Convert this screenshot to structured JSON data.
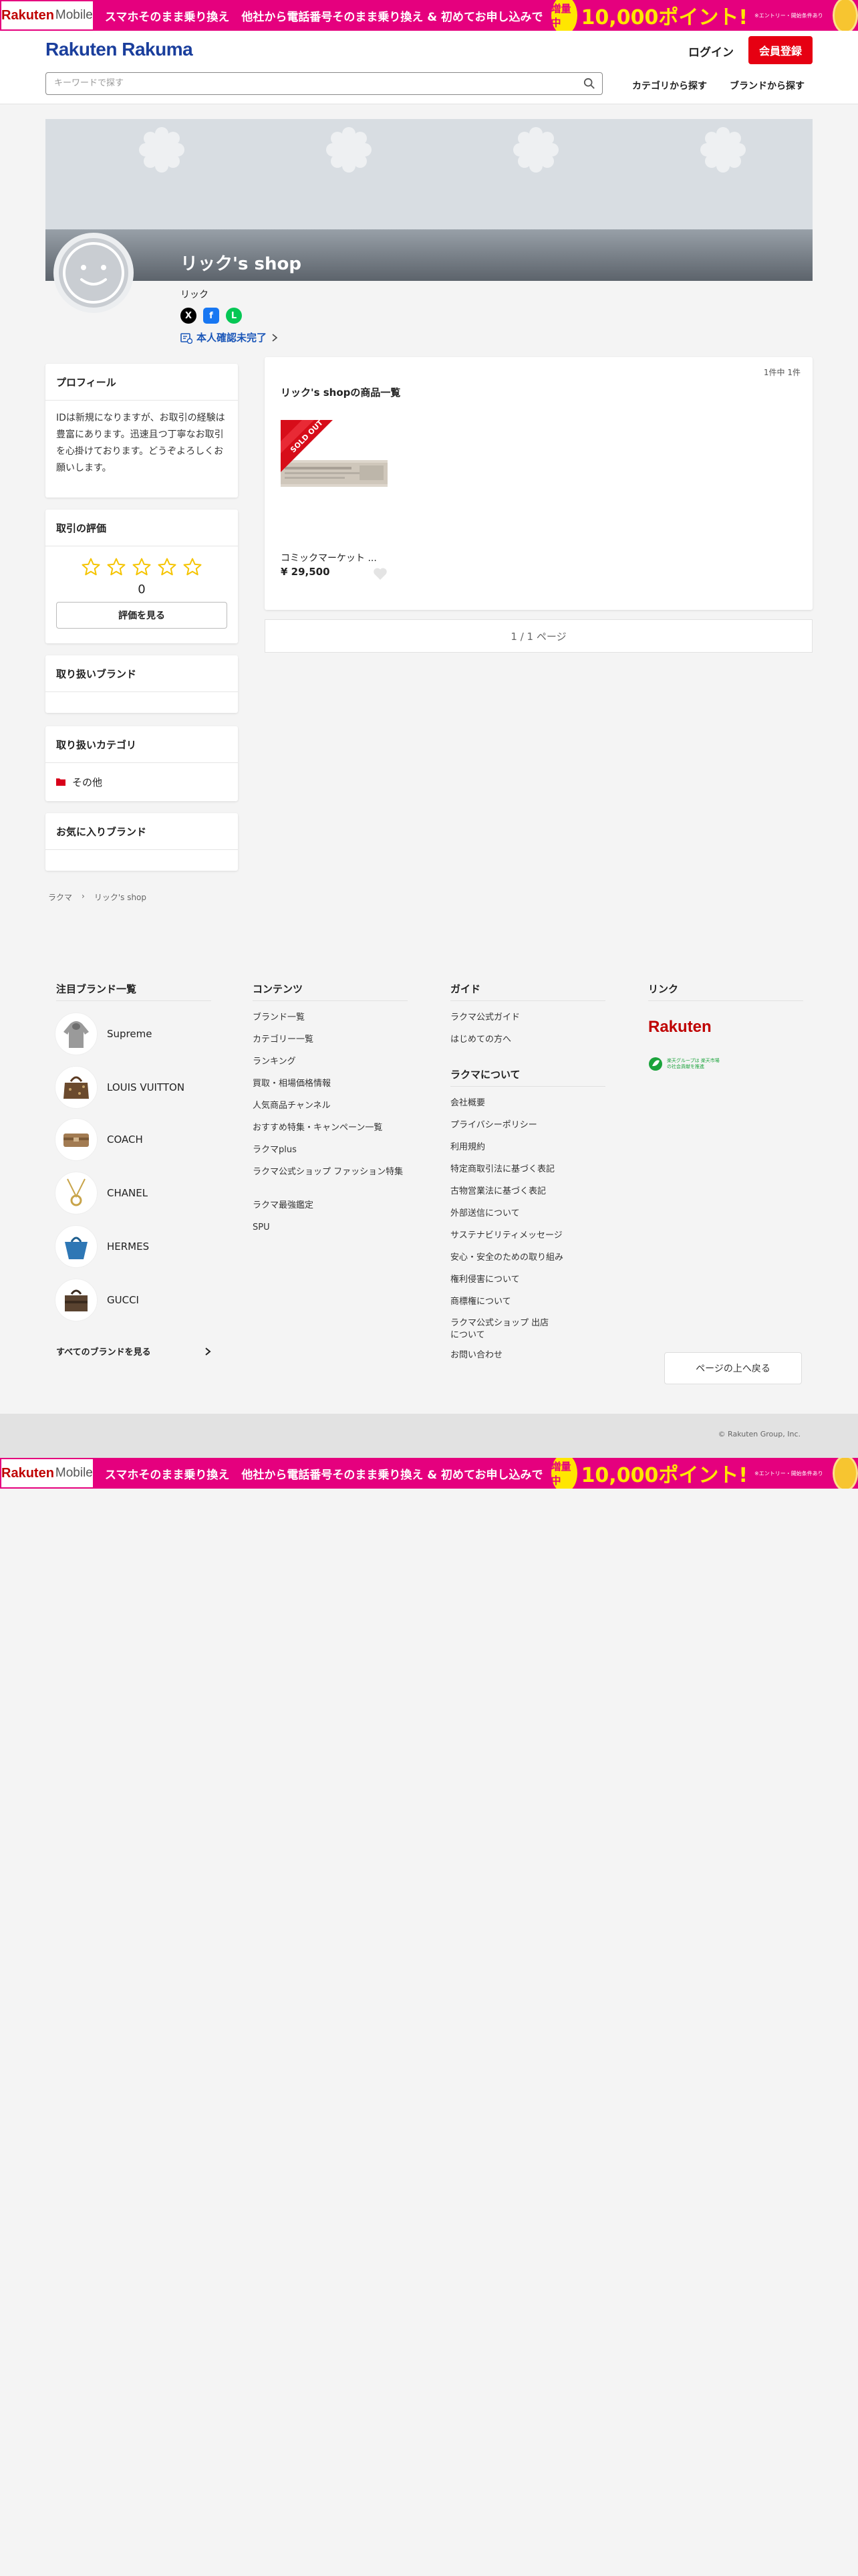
{
  "promo": {
    "logo": "Rakuten",
    "logo_sub": "Mobile",
    "text1": "スマホそのまま乗り換え",
    "text2": "他社から電話番号そのまま乗り換え & 初めてお申し込みで",
    "badge": "増量中",
    "points": "10,000ポイント!",
    "note": "※エントリー・開始条件あり"
  },
  "header": {
    "logo": "Rakuten Rakuma",
    "login": "ログイン",
    "signup": "会員登録",
    "search_placeholder": "キーワードで探す",
    "nav_category": "カテゴリから探す",
    "nav_brand": "ブランドから探す"
  },
  "shop": {
    "name": "リック's shop",
    "owner": "リック",
    "verified": "本人確認未完了"
  },
  "profile": {
    "title": "プロフィール",
    "text": "IDは新規になりますが、お取引の経験は豊富にあります。迅速且つ丁寧なお取引を心掛けております。どうぞよろしくお願いします。"
  },
  "rating": {
    "title": "取引の評価",
    "count": "0",
    "button": "評価を見る",
    "stars": 0
  },
  "brands_box": {
    "title": "取り扱いブランド"
  },
  "categories_box": {
    "title": "取り扱いカテゴリ",
    "items": [
      "その他"
    ]
  },
  "fav_brands_box": {
    "title": "お気に入りブランド"
  },
  "products": {
    "count_text": "1件中 1件",
    "title": "リック's shopの商品一覧",
    "items": [
      {
        "name": "コミックマーケット ...",
        "price": "¥ 29,500",
        "badge": "SOLD OUT"
      }
    ],
    "pager": "1 / 1 ページ"
  },
  "breadcrumb": [
    "ラクマ",
    "リック's shop"
  ],
  "footer": {
    "brands_title": "注目ブランド一覧",
    "brands": [
      "Supreme",
      "LOUIS VUITTON",
      "COACH",
      "CHANEL",
      "HERMES",
      "GUCCI"
    ],
    "all_brands": "すべてのブランドを見る",
    "contents_title": "コンテンツ",
    "contents": [
      "ブランド一覧",
      "カテゴリー一覧",
      "ランキング",
      "買取・相場価格情報",
      "人気商品チャンネル",
      "おすすめ特集・キャンペーン一覧",
      "ラクマplus",
      "ラクマ公式ショップ ファッション特集",
      "ラクマ最強鑑定",
      "SPU"
    ],
    "guide_title": "ガイド",
    "guide": [
      "ラクマ公式ガイド",
      "はじめての方へ"
    ],
    "about_title": "ラクマについて",
    "about": [
      "会社概要",
      "プライバシーポリシー",
      "利用規約",
      "特定商取引法に基づく表記",
      "古物営業法に基づく表記",
      "外部送信について",
      "サステナビリティメッセージ",
      "安心・安全のための取り組み",
      "権利侵害について",
      "商標権について",
      "ラクマ公式ショップ 出店について",
      "お問い合わせ"
    ],
    "links_title": "リンク",
    "link_rakuten": "Rakuten",
    "link_badge": "楽天グループは 楽天市場の社会貢献を推進",
    "to_top": "ページの上へ戻る",
    "copyright": "© Rakuten Group, Inc."
  },
  "colors": {
    "brand_blue": "#1a3e9c",
    "signup_red": "#e60012",
    "promo_pink": "#e5007e",
    "star_yellow": "#f5c400"
  }
}
